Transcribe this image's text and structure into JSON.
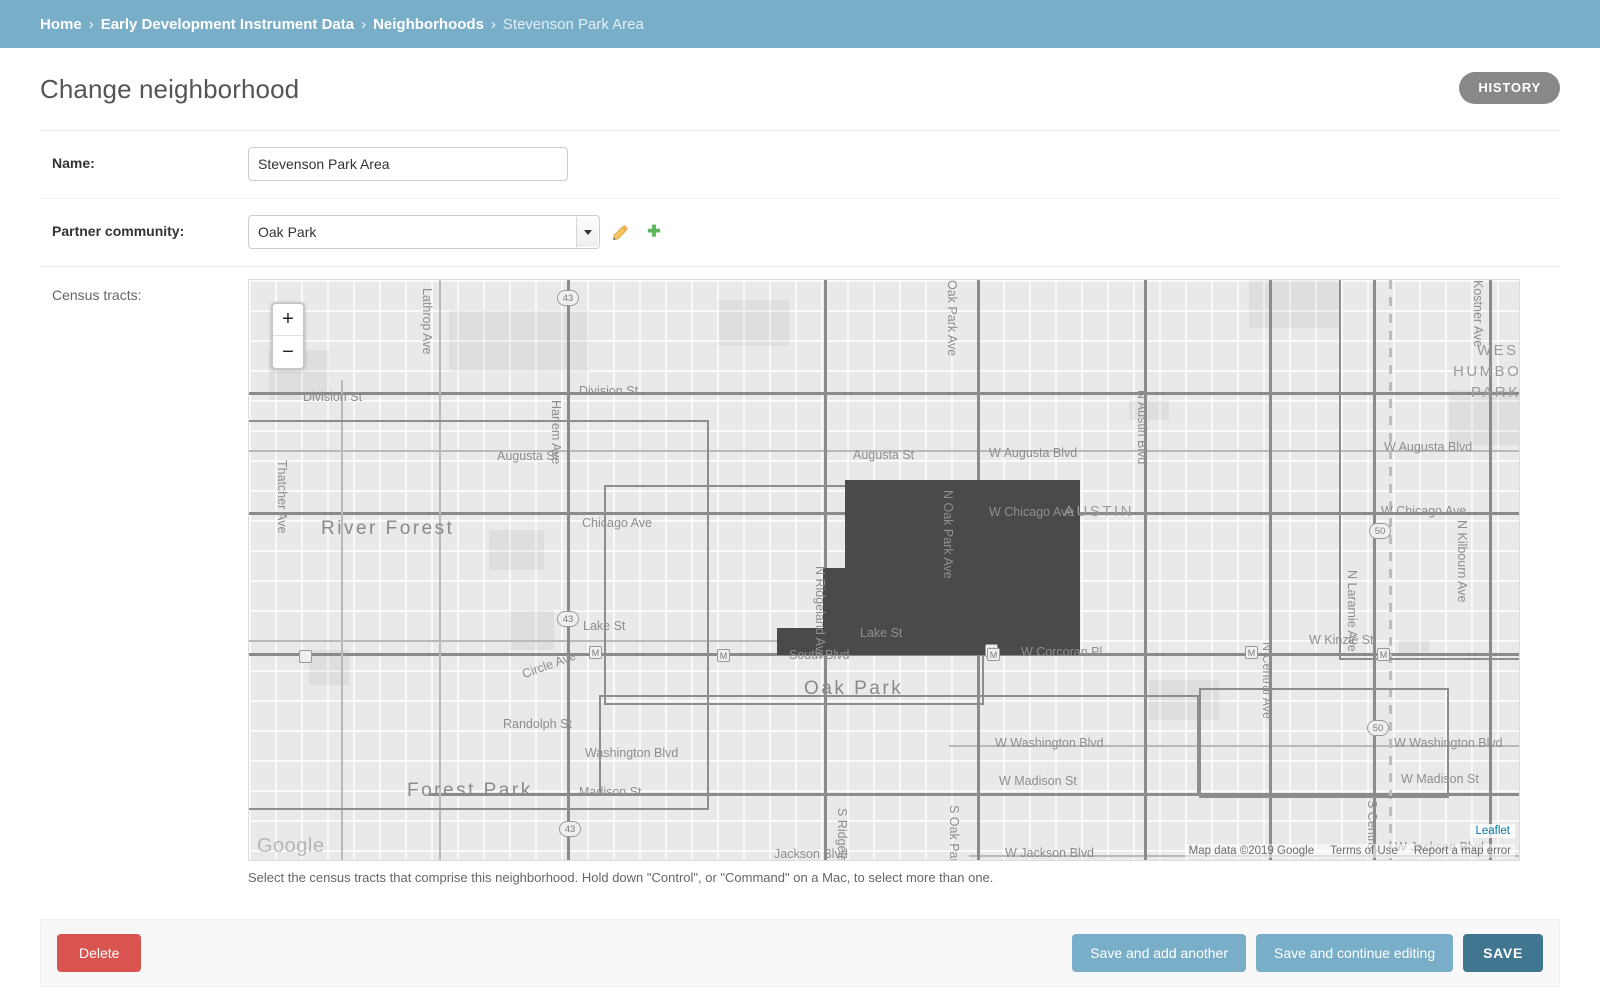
{
  "breadcrumb": {
    "items": [
      {
        "label": "Home",
        "current": false
      },
      {
        "label": "Early Development Instrument Data",
        "current": false
      },
      {
        "label": "Neighborhoods",
        "current": false
      },
      {
        "label": "Stevenson Park Area",
        "current": true
      }
    ],
    "separator": "›"
  },
  "header": {
    "title": "Change neighborhood",
    "history_label": "HISTORY"
  },
  "form": {
    "name_label": "Name:",
    "name_value": "Stevenson Park Area",
    "name_placeholder": "",
    "partner_label": "Partner community:",
    "partner_value": "Oak Park",
    "edit_icon_title": "Change selected partner community",
    "add_icon_title": "Add another partner community",
    "census_label": "Census tracts:",
    "help_text": "Select the census tracts that comprise this neighborhood. Hold down \"Control\", or \"Command\" on a Mac, to select more than one."
  },
  "map": {
    "zoom_in": "+",
    "zoom_out": "−",
    "google_watermark": "Google",
    "leaflet_label": "Leaflet",
    "attribution": {
      "map_data": "Map data ©2019 Google",
      "terms": "Terms of Use",
      "report": "Report a map error"
    },
    "selected_tract_color": "#4a4a4a",
    "labels": {
      "lathrop_ave": "Lathrop Ave",
      "division_st_left": "Division St",
      "division_st_right": "Division St",
      "thatcher_ave": "Thatcher Ave",
      "river_forest": "River Forest",
      "augusta_st_left": "Augusta St",
      "harlem_ave": "Harlem Ave",
      "chicago_ave": "Chicago Ave",
      "lake_st_left": "Lake St",
      "circle_ave": "Circle Ave",
      "randolph_st": "Randolph St",
      "washington_blvd_left": "Washington Blvd",
      "forest_park": "Forest Park",
      "madison_st": "Madison St",
      "jackson_blvd": "Jackson Blvd",
      "oak_park_ave": "Oak Park Ave",
      "n_oak_park_ave": "N Oak Park Ave",
      "s_oak_park_ave": "S Oak Park",
      "ridgeland_ave": "N Ridgeland Ave",
      "augusta_st_mid": "Augusta St",
      "w_augusta_blvd_mid": "W Augusta Blvd",
      "w_augusta_blvd_right": "W Augusta Blvd",
      "austin": "AUSTIN",
      "w_chicago_ave_mid": "W Chicago Ave",
      "w_chicago_ave_right": "W Chicago Ave",
      "n_austin_blvd": "N Austin Blvd",
      "lake_st_mid": "Lake St",
      "south_blvd": "South Blvd",
      "w_corcoran_pl": "W Corcoran Pl",
      "oak_park": "Oak Park",
      "w_washington_blvd": "W Washington Blvd",
      "washington_blvd_right": "W Washington Blvd",
      "w_madison_st": "W Madison St",
      "w_madison_st_right": "W Madison St",
      "w_jackson_blvd": "W Jackson Blvd",
      "w_jackson_blvd_right": "W Jackson Blvd",
      "s_ridgeland": "S Ridgeland",
      "n_central_ave": "N Central Ave",
      "s_central": "S Central",
      "n_laramie_ave": "N Laramie Ave",
      "n_kilbourn_ave": "N Kilbourn Ave",
      "kostner_ave": "Kostner Ave",
      "w_kinzie_st": "W Kinzie St",
      "west_humboldt_park_1": "WEST",
      "west_humboldt_park_2": "HUMBOLDT",
      "west_humboldt_park_3": "PARK",
      "shield_43": "43",
      "shield_50": "50",
      "station_m": "M"
    }
  },
  "footer": {
    "delete_label": "Delete",
    "save_add_another_label": "Save and add another",
    "save_continue_label": "Save and continue editing",
    "save_label": "SAVE"
  }
}
